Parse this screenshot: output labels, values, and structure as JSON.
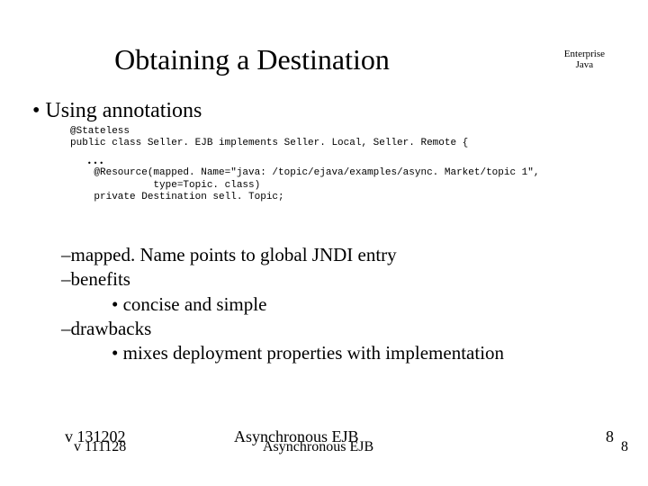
{
  "title": "Obtaining a Destination",
  "corner": {
    "line1": "Enterprise",
    "line2": "Java"
  },
  "bullet_main": "• Using annotations",
  "code": {
    "l1": "@Stateless",
    "l2": "public class Seller. EJB implements Seller. Local, Seller. Remote {",
    "ellipsis": "…",
    "l3": "    @Resource(mapped. Name=\"java: /topic/ejava/examples/async. Market/topic 1\",",
    "l4": "              type=Topic. class)",
    "l5": "    private Destination sell. Topic;"
  },
  "body": {
    "i1": "mapped. Name points to global JNDI entry",
    "i2": "benefits",
    "i2a": "concise and simple",
    "i3": "drawbacks",
    "i3a": "mixes deployment properties with implementation"
  },
  "footer": {
    "ver_a": "v 131202",
    "ver_b": "v 111128",
    "title_a": "Asynchronous EJB",
    "title_b": "Asynchronous EJB",
    "page_a": "8",
    "page_b": "8"
  }
}
